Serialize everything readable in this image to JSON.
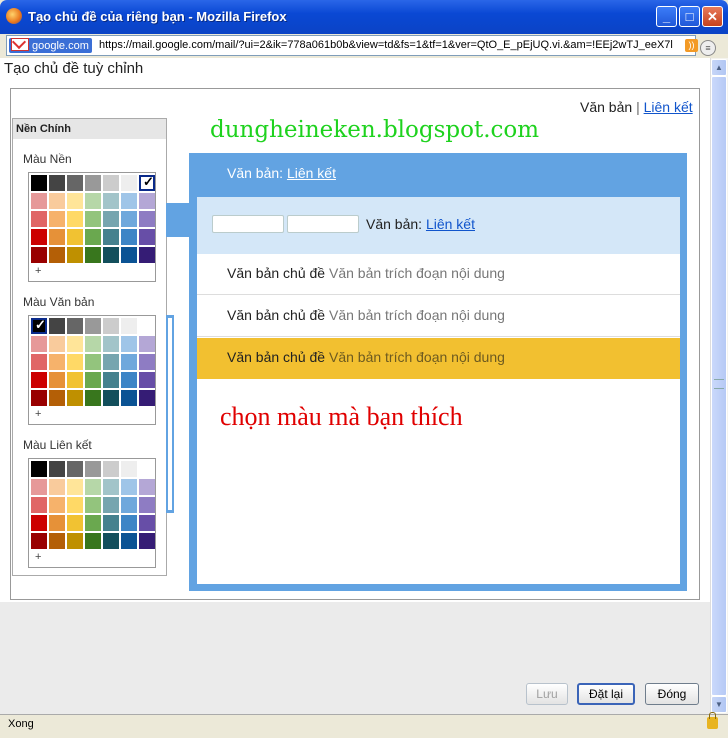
{
  "window": {
    "title": "Tạo chủ đề của riêng bạn - Mozilla Firefox",
    "minimize": "_",
    "maximize": "□",
    "close": "✕"
  },
  "address": {
    "site": "google.com",
    "url": "https://mail.google.com/mail/?ui=2&ik=778a061b0b&view=td&fs=1&tf=1&ver=QtO_E_pEjUQ.vi.&am=!EEj2wTJ_eeX7l"
  },
  "page": {
    "title": "Tạo chủ đề tuỳ chỉnh"
  },
  "top_links": {
    "text": "Văn bản",
    "sep": "|",
    "link": "Liên kết"
  },
  "left_panel": {
    "heading": "Nền Chính",
    "sections": [
      {
        "label": "Màu Nền",
        "selected": 6
      },
      {
        "label": "Màu Văn bản",
        "selected": 0
      },
      {
        "label": "Màu Liên kết",
        "selected": -1
      }
    ],
    "plus": "+",
    "tick": "✓"
  },
  "palette_colors": [
    [
      "#000000",
      "#444444",
      "#666666",
      "#999999",
      "#cccccc",
      "#eeeeee",
      "#ffffff"
    ],
    [
      "#e69999",
      "#f9cb9c",
      "#ffe599",
      "#b6d7a8",
      "#a2c4c9",
      "#9fc5e8",
      "#b4a7d6"
    ],
    [
      "#e06666",
      "#f6b26b",
      "#ffd966",
      "#93c47d",
      "#76a5af",
      "#6fa8dc",
      "#8e7cc3"
    ],
    [
      "#cc0000",
      "#e69138",
      "#f1c232",
      "#6aa84f",
      "#45818e",
      "#3d85c6",
      "#674ea7"
    ],
    [
      "#990000",
      "#b45f06",
      "#bf9000",
      "#38761d",
      "#134f5c",
      "#0b5394",
      "#351c75"
    ]
  ],
  "watermark": "dungheineken.blogspot.com",
  "annotation": "chọn màu mà bạn thích",
  "preview": {
    "header_text": "Văn bản:",
    "header_link": "Liên kết",
    "toolbar_text": "Văn bản:",
    "toolbar_link": "Liên kết",
    "rows": [
      {
        "title": "Văn bản chủ đề",
        "snippet": "Văn bản trích đoạn nội dung"
      },
      {
        "title": "Văn bản chủ đề",
        "snippet": "Văn bản trích đoạn nội dung"
      },
      {
        "title": "Văn bản chủ đề",
        "snippet": "Văn bản trích đoạn nội dung"
      }
    ],
    "colors": {
      "frame": "#62a3e2",
      "toolbar": "#d4e7f8",
      "highlight": "#f2c030"
    }
  },
  "buttons": {
    "save": "Lưu",
    "reset": "Đặt lại",
    "ok": "Đóng"
  },
  "status": {
    "text": "Xong"
  },
  "scrollbar": {
    "up": "▲",
    "down": "▼"
  }
}
